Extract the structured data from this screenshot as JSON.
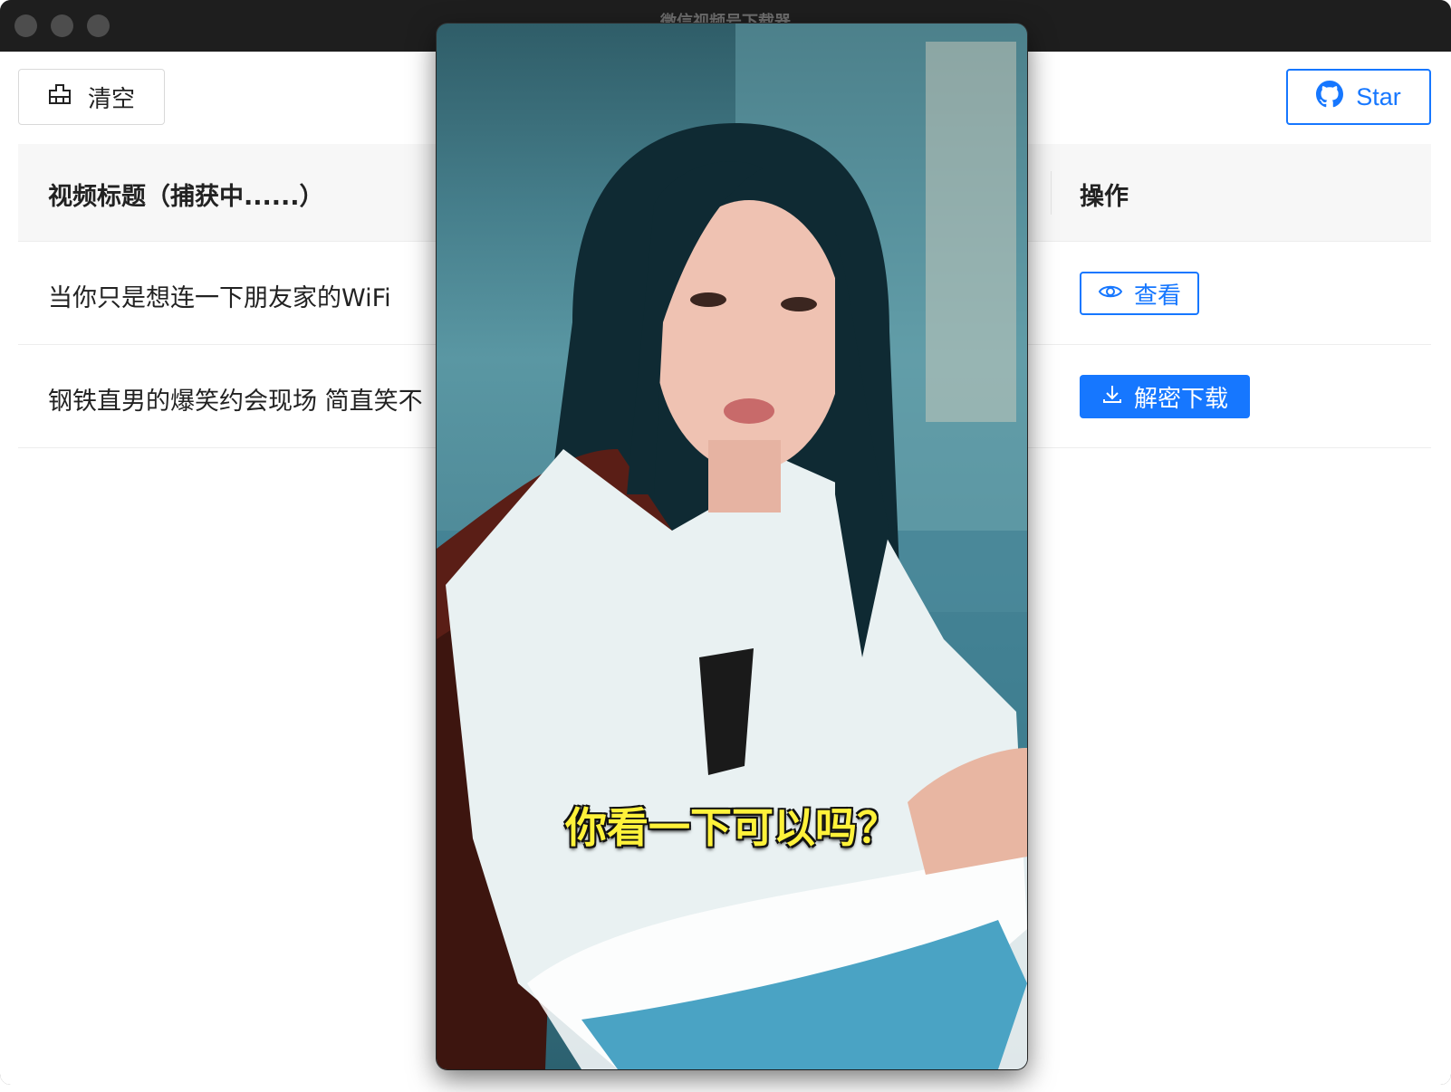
{
  "window": {
    "title": "微信视频号下载器"
  },
  "toolbar": {
    "clear_label": "清空",
    "star_label": "Star"
  },
  "table": {
    "headers": {
      "title": "视频标题（捕获中......）",
      "action": "操作"
    },
    "rows": [
      {
        "title": "当你只是想连一下朋友家的WiFi",
        "action": "查看"
      },
      {
        "title": "钢铁直男的爆笑约会现场 简直笑不",
        "action": "解密下载"
      }
    ]
  },
  "video": {
    "subtitle": "你看一下可以吗？"
  },
  "colors": {
    "accent": "#1677ff",
    "subtitle": "#fff23a",
    "titlebar": "#1e1e1e"
  }
}
